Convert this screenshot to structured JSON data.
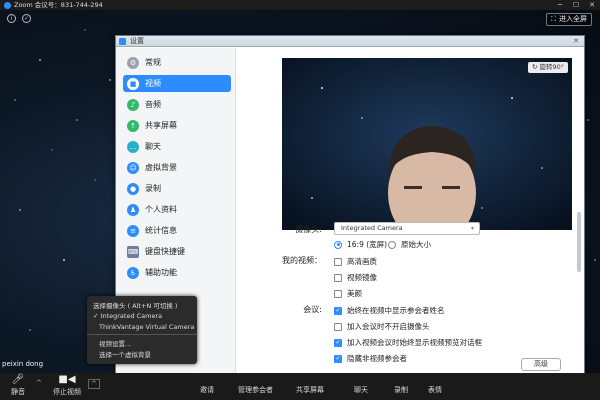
{
  "window": {
    "title": "Zoom 会议号：831-744-294"
  },
  "top_bar": {
    "fullscreen_label": "进入全屏"
  },
  "settings": {
    "title": "设置",
    "sidebar": [
      {
        "label": "常规",
        "icon": "gear-icon",
        "color": "#9aa3ad"
      },
      {
        "label": "视频",
        "icon": "video-camera-icon",
        "color": "#ffffff",
        "active": true
      },
      {
        "label": "音频",
        "icon": "headphones-icon",
        "color": "#34b86e"
      },
      {
        "label": "共享屏幕",
        "icon": "share-screen-icon",
        "color": "#34b86e"
      },
      {
        "label": "聊天",
        "icon": "chat-bubble-icon",
        "color": "#27b0c8"
      },
      {
        "label": "虚拟背景",
        "icon": "virtual-background-icon",
        "color": "#2d8cff"
      },
      {
        "label": "录制",
        "icon": "record-icon",
        "color": "#2d8cff"
      },
      {
        "label": "个人资料",
        "icon": "profile-icon",
        "color": "#2d8cff"
      },
      {
        "label": "统计信息",
        "icon": "statistics-icon",
        "color": "#2d8cff"
      },
      {
        "label": "键盘快捷键",
        "icon": "keyboard-icon",
        "color": "#6e7f99"
      },
      {
        "label": "辅助功能",
        "icon": "accessibility-icon",
        "color": "#2d8cff"
      }
    ],
    "preview": {
      "rotate_label": "旋转90°"
    },
    "camera": {
      "label": "摄像头:",
      "selected": "Integrated Camera"
    },
    "ratio": {
      "option_widescreen": "16:9 (宽屏)",
      "option_original": "原始大小"
    },
    "my_video": {
      "label": "我的视频：",
      "hd": "高清画质",
      "mirror": "视频镜像",
      "touch_up": "美颜"
    },
    "meetings": {
      "label": "会议:",
      "show_names": "始终在视频中显示参会者姓名",
      "turn_off_video": "加入会议时不开启摄像头",
      "preview_dialog": "加入视频会议时始终显示视频预览对话框",
      "hide_nonvideo": "隐藏非视频参会者"
    },
    "advanced_label": "高级"
  },
  "camera_popup": {
    "header": "选择摄像头 ( Alt+N 可切换 )",
    "options": [
      "Integrated Camera",
      "ThinkVantage Virtual Camera"
    ],
    "video_settings": "视频设置...",
    "choose_background": "选择一个虚拟背景"
  },
  "participant_name": "peixin dong",
  "toolbar": {
    "mute": "静音",
    "stop_video": "停止视频",
    "invite": "邀请",
    "manage_participants": "管理参会者",
    "share_screen": "共享屏幕",
    "chat": "聊天",
    "record": "录制",
    "reactions": "表情"
  }
}
